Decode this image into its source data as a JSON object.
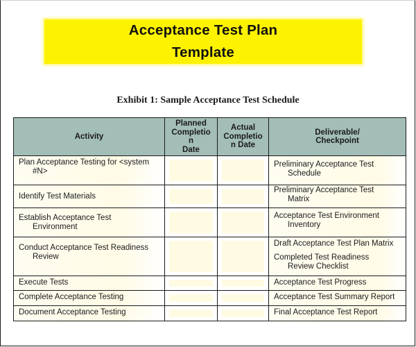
{
  "title": {
    "line1": "Acceptance Test Plan",
    "line2": "Template",
    "highlight_color": "#fdf200"
  },
  "exhibit_caption": "Exhibit 1: Sample Acceptance Test Schedule",
  "table": {
    "header_color": "#a3bdb7",
    "columns": {
      "activity": "Activity",
      "planned": [
        "Planned",
        "Completio",
        "n",
        "Date"
      ],
      "actual": [
        "Actual",
        "Completio",
        "n Date"
      ],
      "deliverable": [
        "Deliverable/",
        "Checkpoint"
      ]
    },
    "rows": [
      {
        "activity": [
          "Plan Acceptance Testing for <system",
          "#N>"
        ],
        "planned_date": "",
        "actual_date": "",
        "deliverables": [
          [
            "Preliminary Acceptance Test",
            "Schedule"
          ]
        ]
      },
      {
        "activity": [
          "Identify Test Materials"
        ],
        "planned_date": "",
        "actual_date": "",
        "deliverables": [
          [
            "Preliminary Acceptance Test",
            "Matrix"
          ]
        ]
      },
      {
        "activity": [
          "Establish Acceptance Test",
          "Environment"
        ],
        "planned_date": "",
        "actual_date": "",
        "deliverables": [
          [
            "Acceptance Test Environment",
            "Inventory"
          ]
        ]
      },
      {
        "activity": [
          "Conduct Acceptance Test Readiness",
          "Review"
        ],
        "planned_date": "",
        "actual_date": "",
        "deliverables": [
          [
            "Draft Acceptance Test Plan Matrix"
          ],
          [
            "Completed Test Readiness",
            "Review Checklist"
          ]
        ]
      },
      {
        "activity": [
          "Execute Tests"
        ],
        "planned_date": "",
        "actual_date": "",
        "deliverables": [
          [
            "Acceptance Test Progress"
          ]
        ]
      },
      {
        "activity": [
          "Complete Acceptance Testing"
        ],
        "planned_date": "",
        "actual_date": "",
        "deliverables": [
          [
            "Acceptance Test Summary Report"
          ]
        ]
      },
      {
        "activity": [
          "Document Acceptance Testing"
        ],
        "planned_date": "",
        "actual_date": "",
        "deliverables": [
          [
            "Final Acceptance Test Report"
          ]
        ]
      }
    ]
  }
}
